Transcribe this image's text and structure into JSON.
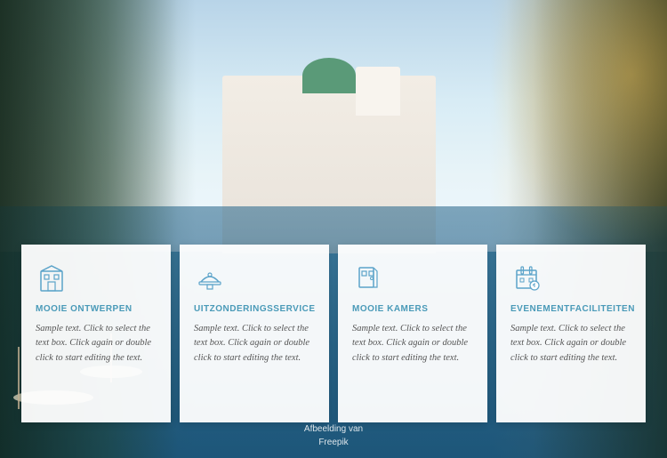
{
  "background": {
    "alt": "Hotel pool resort background"
  },
  "attribution": {
    "line1": "Afbeelding van",
    "line2": "Freepik"
  },
  "cards": [
    {
      "id": "card-1",
      "icon": "building-icon",
      "title": "MOOIE ONTWERPEN",
      "text": "Sample text. Click to select the text box. Click again or double click to start editing the text."
    },
    {
      "id": "card-2",
      "icon": "service-icon",
      "title": "UITZONDERINGSSERVICE",
      "text": "Sample text. Click to select the text box. Click again or double click to start editing the text."
    },
    {
      "id": "card-3",
      "icon": "room-icon",
      "title": "MOOIE KAMERS",
      "text": "Sample text. Click to select the text box. Click again or double click to start editing the text."
    },
    {
      "id": "card-4",
      "icon": "event-icon",
      "title": "EVENEMENTFACILITEITEN",
      "text": "Sample text. Click to select the text box. Click again or double click to start editing the text."
    }
  ]
}
